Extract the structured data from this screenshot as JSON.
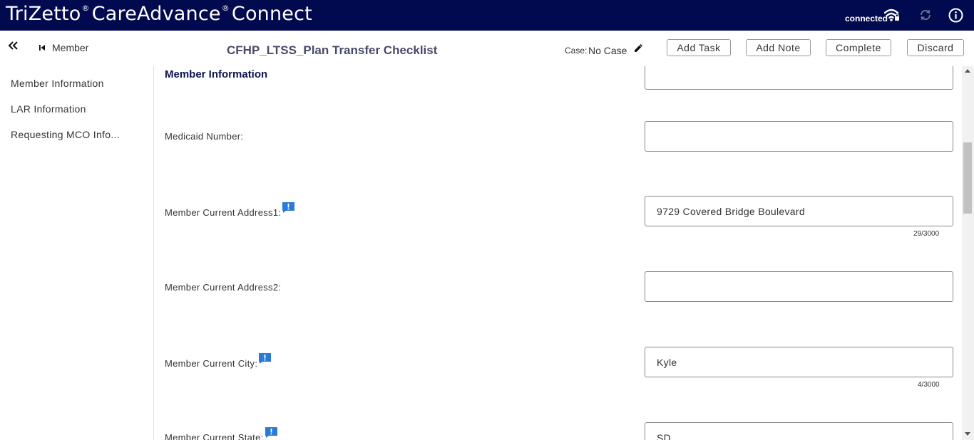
{
  "app": {
    "brand_part1": "TriZetto",
    "brand_part2": "CareAdvance",
    "brand_part3": "Connect",
    "reg_mark": "®",
    "status": "connected",
    "colors": {
      "topbar": "#020a4f",
      "title": "#4a4a6a",
      "section": "#0d1450",
      "note_icon": "#2b7bd6"
    }
  },
  "header": {
    "back_label": "Member",
    "title": "CFHP_LTSS_Plan Transfer Checklist",
    "case_label": "Case:",
    "case_value": "No Case",
    "buttons": {
      "add_task": "Add Task",
      "add_note": "Add Note",
      "complete": "Complete",
      "discard": "Discard"
    }
  },
  "sidebar": {
    "items": [
      {
        "label": "Member Information"
      },
      {
        "label": "LAR Information"
      },
      {
        "label": "Requesting MCO Info..."
      }
    ]
  },
  "main": {
    "section_title": "Member Information",
    "fields": [
      {
        "label": "",
        "value": ""
      },
      {
        "label": "Medicaid Number:",
        "value": ""
      },
      {
        "label": "Member Current Address1:",
        "value": "9729 Covered Bridge Boulevard",
        "counter": "29/3000"
      },
      {
        "label": "Member Current Address2:",
        "value": ""
      },
      {
        "label": "Member Current City:",
        "value": "Kyle",
        "counter": "4/3000"
      },
      {
        "label": "Member Current State:",
        "value": "SD"
      }
    ]
  }
}
